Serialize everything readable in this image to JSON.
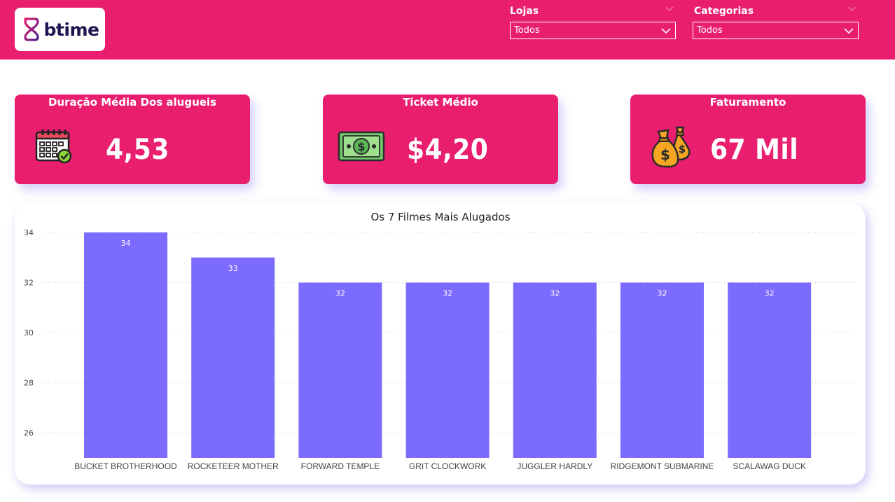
{
  "header": {
    "logo_text": "btime",
    "slicers": [
      {
        "title": "Lojas",
        "value": "Todos"
      },
      {
        "title": "Categorias",
        "value": "Todos"
      }
    ]
  },
  "kpis": [
    {
      "title": "Duração Média Dos alugueis",
      "value": "4,53",
      "icon": "calendar-check-icon"
    },
    {
      "title": "Ticket Médio",
      "value": "$4,20",
      "icon": "dollar-bill-icon"
    },
    {
      "title": "Faturamento",
      "value": "67 Mil",
      "icon": "money-bags-icon"
    }
  ],
  "colors": {
    "brand_pink": "#e91e6f",
    "bar": "#7b6bff",
    "logo_gradient_start": "#e91e6f",
    "logo_gradient_end": "#4a1f8c"
  },
  "chart_data": {
    "type": "bar",
    "title": "Os 7 Filmes Mais Alugados",
    "categories": [
      "BUCKET BROTHERHOOD",
      "ROCKETEER MOTHER",
      "FORWARD TEMPLE",
      "GRIT CLOCKWORK",
      "JUGGLER HARDLY",
      "RIDGEMONT SUBMARINE",
      "SCALAWAG DUCK"
    ],
    "values": [
      34,
      33,
      32,
      32,
      32,
      32,
      32
    ],
    "data_labels": [
      "34",
      "33",
      "32",
      "32",
      "32",
      "32",
      "32"
    ],
    "ylim": [
      25,
      34
    ],
    "yticks": [
      26,
      28,
      30,
      32,
      34
    ],
    "ytick_labels": [
      "26",
      "28",
      "30",
      "32",
      "34"
    ],
    "grid": true,
    "xlabel": "",
    "ylabel": ""
  }
}
